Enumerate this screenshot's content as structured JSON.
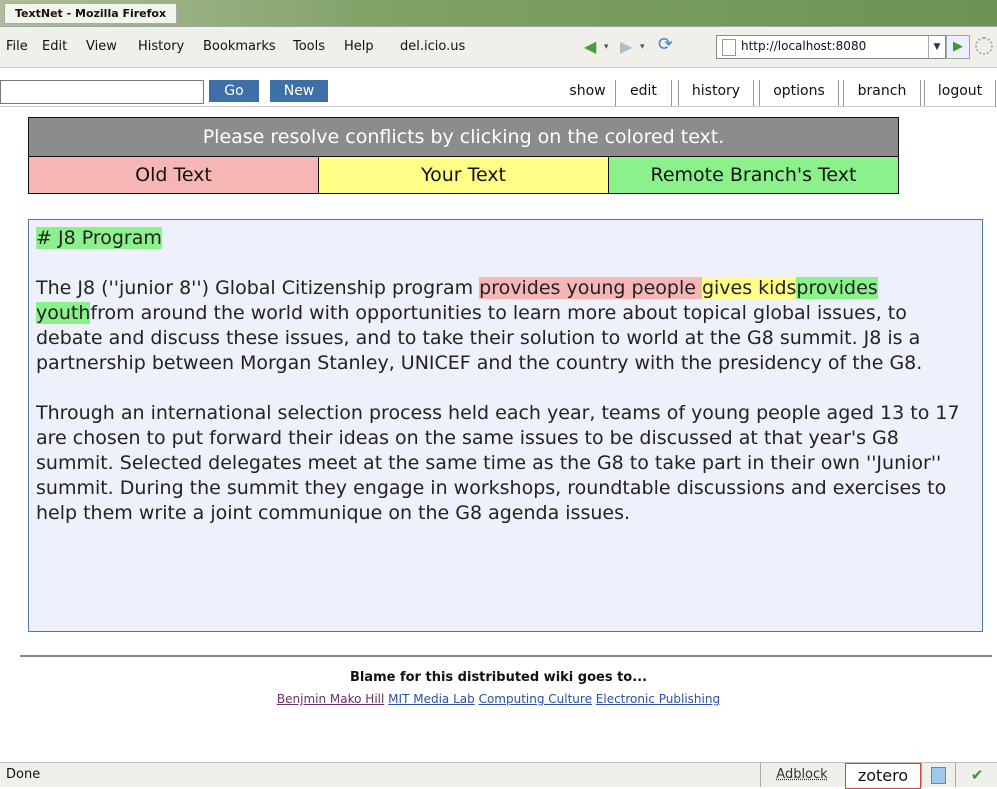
{
  "window": {
    "title": "TextNet - Mozilla Firefox"
  },
  "menu": [
    "File",
    "Edit",
    "View",
    "History",
    "Bookmarks",
    "Tools",
    "Help",
    "del.icio.us"
  ],
  "url": "http://localhost:8080",
  "toolbar": {
    "search_value": "",
    "go_label": "Go",
    "new_label": "New",
    "tabs": [
      "show",
      "edit",
      "history",
      "options",
      "branch",
      "logout"
    ]
  },
  "legend": {
    "header": "Please resolve conflicts by clicking on the colored text.",
    "old": "Old Text",
    "yours": "Your Text",
    "remote": "Remote Branch's Text",
    "colors": {
      "old": "#f7b6b6",
      "yours": "#ffff88",
      "remote": "#8bf28b"
    }
  },
  "content": {
    "heading": "# J8 Program",
    "p1_pre": "The J8 (''junior 8'') Global Citizenship program ",
    "p1_old": "provides young people ",
    "p1_yours": "gives kids",
    "p1_remote": "provides youth",
    "p1_post": "from around the world with opportunities to learn more about topical global issues, to debate and discuss these issues, and to take their solution to world at the G8 summit. J8 is a partnership between Morgan Stanley, UNICEF and the country with the presidency of the G8.",
    "p2": "Through an international selection process held each year, teams of young people aged 13 to 17 are chosen to put forward their ideas on the same issues to be discussed at that year's G8 summit. Selected delegates meet at the same time as the G8 to take part in their own ''Junior'' summit. During the summit they engage in workshops, roundtable discussions and exercises to help them write a joint communique on the G8 agenda issues."
  },
  "footer": {
    "title": "Blame for this distributed wiki goes to...",
    "links": [
      "Benjmin Mako Hill",
      "MIT Media Lab",
      "Computing Culture",
      "Electronic Publishing"
    ]
  },
  "status": {
    "text": "Done",
    "adblock": "Adblock",
    "zotero": "zotero"
  }
}
